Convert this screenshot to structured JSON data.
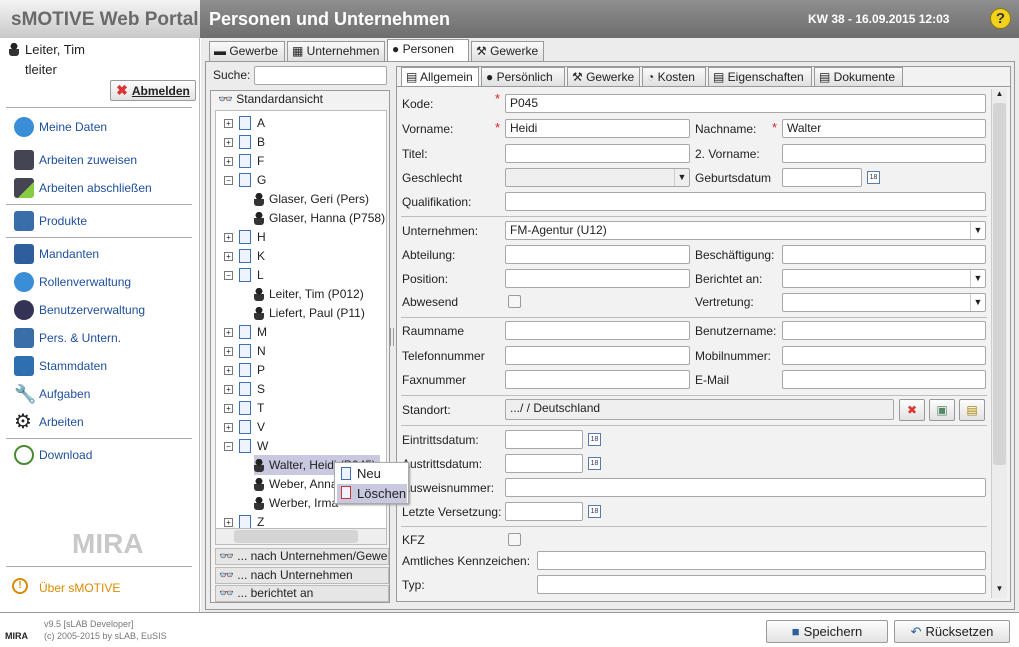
{
  "header": {
    "app_title": "sMOTIVE Web Portal",
    "page_title": "Personen und Unternehmen",
    "date": "KW 38 - 16.09.2015 12:03",
    "help": "?"
  },
  "user": {
    "name": "Leiter, Tim",
    "login": "tleiter",
    "logout": "Abmelden"
  },
  "nav": [
    {
      "label": "Meine Daten",
      "icon": "user-data-icon"
    },
    {
      "label": "Arbeiten zuweisen",
      "icon": "assign-work-icon"
    },
    {
      "label": "Arbeiten abschließen",
      "icon": "complete-work-icon"
    },
    {
      "label": "Produkte",
      "icon": "products-icon"
    },
    {
      "label": "Mandanten",
      "icon": "clients-icon"
    },
    {
      "label": "Rollenverwaltung",
      "icon": "roles-icon"
    },
    {
      "label": "Benutzerverwaltung",
      "icon": "users-icon"
    },
    {
      "label": "Pers. & Untern.",
      "icon": "persons-companies-icon"
    },
    {
      "label": "Stammdaten",
      "icon": "master-data-icon"
    },
    {
      "label": "Aufgaben",
      "icon": "tasks-icon"
    },
    {
      "label": "Arbeiten",
      "icon": "gear-icon"
    },
    {
      "label": "Download",
      "icon": "download-icon"
    }
  ],
  "about": "Über sMOTIVE",
  "logo": "MIRA",
  "footer": {
    "version": "v9.5 [sLAB Developer]",
    "copyright": "(c) 2005-2015 by sLAB, EuSIS",
    "save": "Speichern",
    "reset": "Rücksetzen"
  },
  "outer_tabs": [
    "Gewerbe",
    "Unternehmen",
    "Personen",
    "Gewerke"
  ],
  "tree": {
    "search_label": "Suche:",
    "search_value": "",
    "view": "Standardansicht",
    "rows": [
      {
        "t": "A",
        "k": "g",
        "e": "+"
      },
      {
        "t": "B",
        "k": "g",
        "e": "+"
      },
      {
        "t": "F",
        "k": "g",
        "e": "+"
      },
      {
        "t": "G",
        "k": "g",
        "e": "−"
      },
      {
        "t": "Glaser, Geri (Pers)",
        "k": "p"
      },
      {
        "t": "Glaser, Hanna (P758)",
        "k": "p"
      },
      {
        "t": "H",
        "k": "g",
        "e": "+"
      },
      {
        "t": "K",
        "k": "g",
        "e": "+"
      },
      {
        "t": "L",
        "k": "g",
        "e": "−"
      },
      {
        "t": "Leiter, Tim (P012)",
        "k": "p"
      },
      {
        "t": "Liefert, Paul (P11)",
        "k": "p"
      },
      {
        "t": "M",
        "k": "g",
        "e": "+"
      },
      {
        "t": "N",
        "k": "g",
        "e": "+"
      },
      {
        "t": "P",
        "k": "g",
        "e": "+"
      },
      {
        "t": "S",
        "k": "g",
        "e": "+"
      },
      {
        "t": "T",
        "k": "g",
        "e": "+"
      },
      {
        "t": "V",
        "k": "g",
        "e": "+"
      },
      {
        "t": "W",
        "k": "g",
        "e": "−"
      },
      {
        "t": "Walter, Heidi (P045)",
        "k": "p",
        "sel": true
      },
      {
        "t": "Weber, Anna",
        "k": "p"
      },
      {
        "t": "Werber, Irma",
        "k": "p"
      },
      {
        "t": "Z",
        "k": "g",
        "e": "+"
      }
    ],
    "views": [
      "... nach Unternehmen/Gewe",
      "... nach Unternehmen",
      "... berichtet an"
    ]
  },
  "context_menu": [
    "Neu",
    "Löschen"
  ],
  "form_tabs": [
    "Allgemein",
    "Persönlich",
    "Gewerke",
    "Kosten",
    "Eigenschaften",
    "Dokumente"
  ],
  "form": {
    "kode": {
      "label": "Kode:",
      "value": "P045"
    },
    "vorname": {
      "label": "Vorname:",
      "value": "Heidi"
    },
    "nachname": {
      "label": "Nachname:",
      "value": "Walter"
    },
    "titel": {
      "label": "Titel:",
      "value": ""
    },
    "vorname2": {
      "label": "2. Vorname:",
      "value": ""
    },
    "geschlecht": {
      "label": "Geschlecht",
      "value": ""
    },
    "geburtsdatum": {
      "label": "Geburtsdatum",
      "value": ""
    },
    "qualifikation": {
      "label": "Qualifikation:",
      "value": ""
    },
    "unternehmen": {
      "label": "Unternehmen:",
      "value": "FM-Agentur (U12)"
    },
    "abteilung": {
      "label": "Abteilung:",
      "value": ""
    },
    "beschaeftigung": {
      "label": "Beschäftigung:",
      "value": ""
    },
    "position": {
      "label": "Position:",
      "value": ""
    },
    "berichtet": {
      "label": "Berichtet an:",
      "value": ""
    },
    "abwesend": {
      "label": "Abwesend",
      "checked": false
    },
    "vertretung": {
      "label": "Vertretung:",
      "value": ""
    },
    "raumname": {
      "label": "Raumname",
      "value": ""
    },
    "benutzername": {
      "label": "Benutzername:",
      "value": ""
    },
    "telefon": {
      "label": "Telefonnummer",
      "value": ""
    },
    "mobil": {
      "label": "Mobilnummer:",
      "value": ""
    },
    "fax": {
      "label": "Faxnummer",
      "value": ""
    },
    "email": {
      "label": "E-Mail",
      "value": ""
    },
    "standort": {
      "label": "Standort:",
      "value": ".../ / Deutschland"
    },
    "eintritt": {
      "label": "Eintrittsdatum:",
      "value": ""
    },
    "austritt": {
      "label": "Austrittsdatum:",
      "value": ""
    },
    "ausweis": {
      "label": "Ausweisnummer:",
      "value": ""
    },
    "versetzung": {
      "label": "Letzte Versetzung:",
      "value": ""
    },
    "kfz": {
      "label": "KFZ",
      "checked": false
    },
    "kennzeichen": {
      "label": "Amtliches Kennzeichen:",
      "value": ""
    },
    "typ": {
      "label": "Typ:",
      "value": ""
    }
  },
  "colors": {
    "link": "#1e4f9c",
    "about": "#d98a00",
    "required": "#dd2222",
    "selection": "#c8c8e0"
  }
}
